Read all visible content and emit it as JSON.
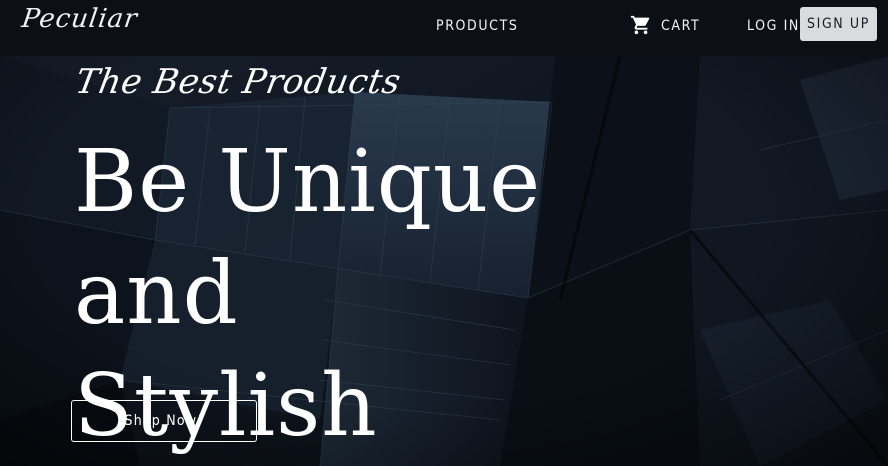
{
  "navbar": {
    "brand": "Peculiar",
    "products_label": "PRODUCTS",
    "cart_label": "CART",
    "cart_icon": "shopping-cart-icon",
    "login_label": "LOG IN",
    "signup_label": "SIGN UP"
  },
  "hero": {
    "tagline": "The Best Products",
    "headline_line1": "Be Unique and",
    "headline_line2": "Stylish",
    "cta_label": "Shop Now!",
    "background_image": "dark geometric architecture"
  },
  "colors": {
    "nav_bg": "#0c0f16",
    "hero_bg": "#0b0f17",
    "text": "#ffffff",
    "signup_bg": "#d9dbdf"
  }
}
